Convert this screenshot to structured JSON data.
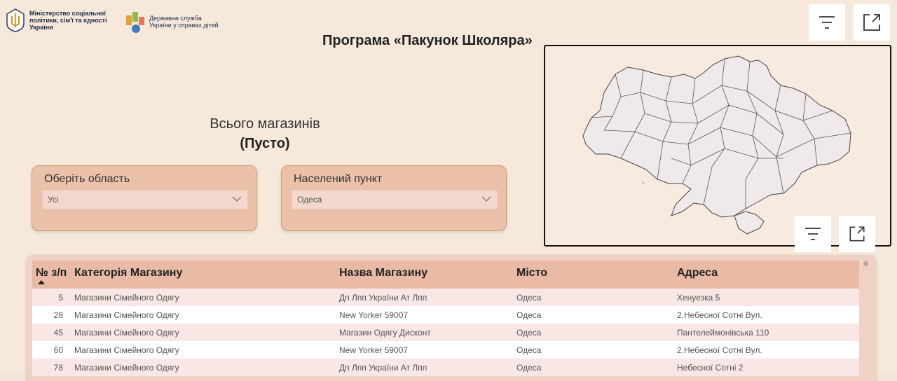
{
  "header": {
    "ministry_name": "Міністерство соціальної політики, сім'ї та єдності України",
    "agency_name": "Державна служба України у справах дітей",
    "title": "Програма «Пакунок Школяра»"
  },
  "summary": {
    "label": "Всього магазинів",
    "value": "(Пусто)"
  },
  "filters": {
    "region": {
      "label": "Оберіть область",
      "value": "Усі"
    },
    "settlement": {
      "label": "Населений пункт",
      "value": "Одеса"
    }
  },
  "icons": {
    "filter": "filter-icon",
    "expand": "expand-icon",
    "chevron": "chevron-down-icon"
  },
  "table": {
    "columns": [
      "№ з/п",
      "Категорія Магазину",
      "Назва Магазину",
      "Місто",
      "Адреса"
    ],
    "rows": [
      {
        "num": "5",
        "category": "Магазини Сімейного Одягу",
        "name": "Дп Лпп України Ат Лпп",
        "city": "Одеса",
        "address": "Хенуезка 5"
      },
      {
        "num": "28",
        "category": "Магазини Сімейного Одягу",
        "name": "New Yorker 59007",
        "city": "Одеса",
        "address": "2.Небесної Сотні Вул."
      },
      {
        "num": "45",
        "category": "Магазини Сімейного Одягу",
        "name": "Магазин Одягу Дисконт",
        "city": "Одеса",
        "address": "Пантелеймонівська 110"
      },
      {
        "num": "60",
        "category": "Магазини Сімейного Одягу",
        "name": "New Yorker 59007",
        "city": "Одеса",
        "address": "2.Небесної Сотні Вул."
      },
      {
        "num": "78",
        "category": "Магазини Сімейного Одягу",
        "name": "Дп Лпп України Ат Лпп",
        "city": "Одеса",
        "address": "Небесної Сотні 2"
      }
    ]
  },
  "colors": {
    "background": "#f6e9dc",
    "slicer": "#ecc1aa",
    "table_header": "#e9baa5",
    "row_alt": "#f8e7e4"
  }
}
